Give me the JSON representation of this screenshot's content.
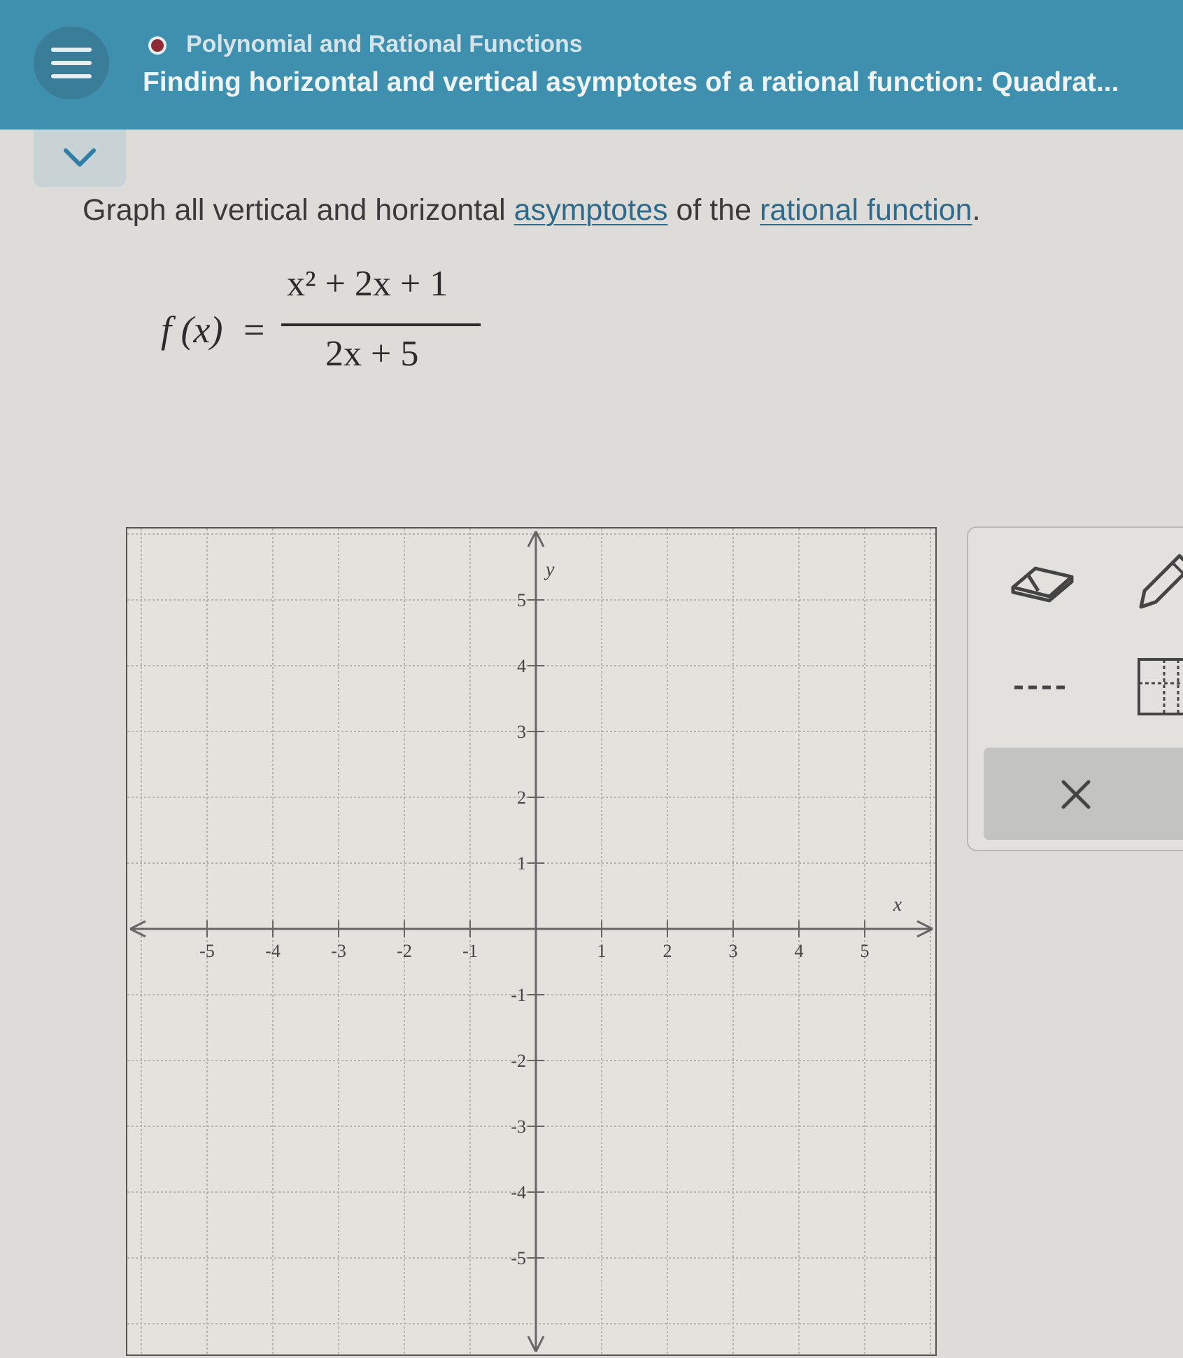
{
  "header": {
    "topic": "Polynomial and Rational Functions",
    "title": "Finding horizontal and vertical asymptotes of a rational function: Quadrat..."
  },
  "question": {
    "prefix": "Graph all vertical and horizontal ",
    "link1": "asymptotes",
    "middle": " of the ",
    "link2": "rational function",
    "suffix": "."
  },
  "formula": {
    "lhs": "f (x)",
    "eq": "=",
    "numerator": "x² + 2x + 1",
    "denominator": "2x + 5"
  },
  "graph": {
    "x_label": "x",
    "y_label": "y",
    "x_range": [
      -6,
      6
    ],
    "y_range": [
      -6,
      6
    ],
    "x_ticks": [
      "-5",
      "-4",
      "-3",
      "-2",
      "-1",
      "1",
      "2",
      "3",
      "4",
      "5"
    ],
    "y_ticks": [
      "5",
      "4",
      "3",
      "2",
      "1",
      "-1",
      "-2",
      "-3",
      "-4",
      "-5"
    ]
  },
  "tools": {
    "eraser": "eraser-icon",
    "pencil": "pencil-icon",
    "dashed": "dashed-line-icon",
    "asymptote": "asymptote-icon",
    "clear": "close-icon"
  },
  "colors": {
    "header": "#3f8fae",
    "link": "#2e6a8c",
    "status_dot": "#8e2b35"
  }
}
